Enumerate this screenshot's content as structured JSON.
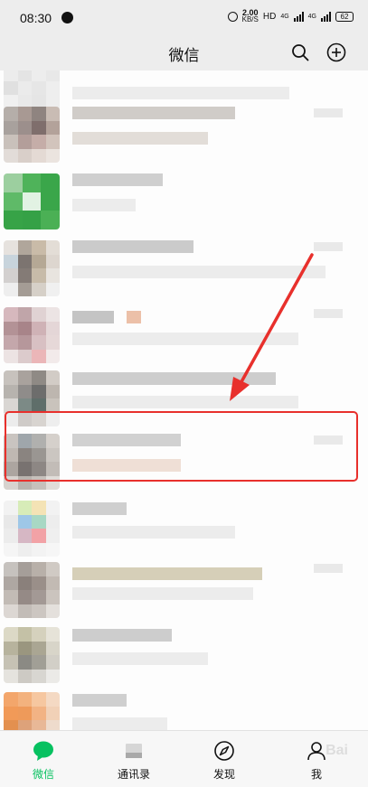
{
  "status_bar": {
    "time": "08:30",
    "net_speed_value": "2.00",
    "net_speed_unit": "KB/S",
    "hd_label": "HD",
    "signal_1_label": "4G",
    "signal_2_label": "4G",
    "battery_level": "62"
  },
  "nav": {
    "title": "微信"
  },
  "tabs": [
    {
      "label": "微信",
      "icon": "chat-bubble-icon",
      "active": true
    },
    {
      "label": "通讯录",
      "icon": "contacts-icon",
      "active": false
    },
    {
      "label": "发现",
      "icon": "compass-icon",
      "active": false
    },
    {
      "label": "我",
      "icon": "person-icon",
      "active": false
    }
  ],
  "watermark": "Bai",
  "colors": {
    "accent": "#07c160",
    "annotation_red": "#e8302c",
    "background": "#ededed"
  }
}
